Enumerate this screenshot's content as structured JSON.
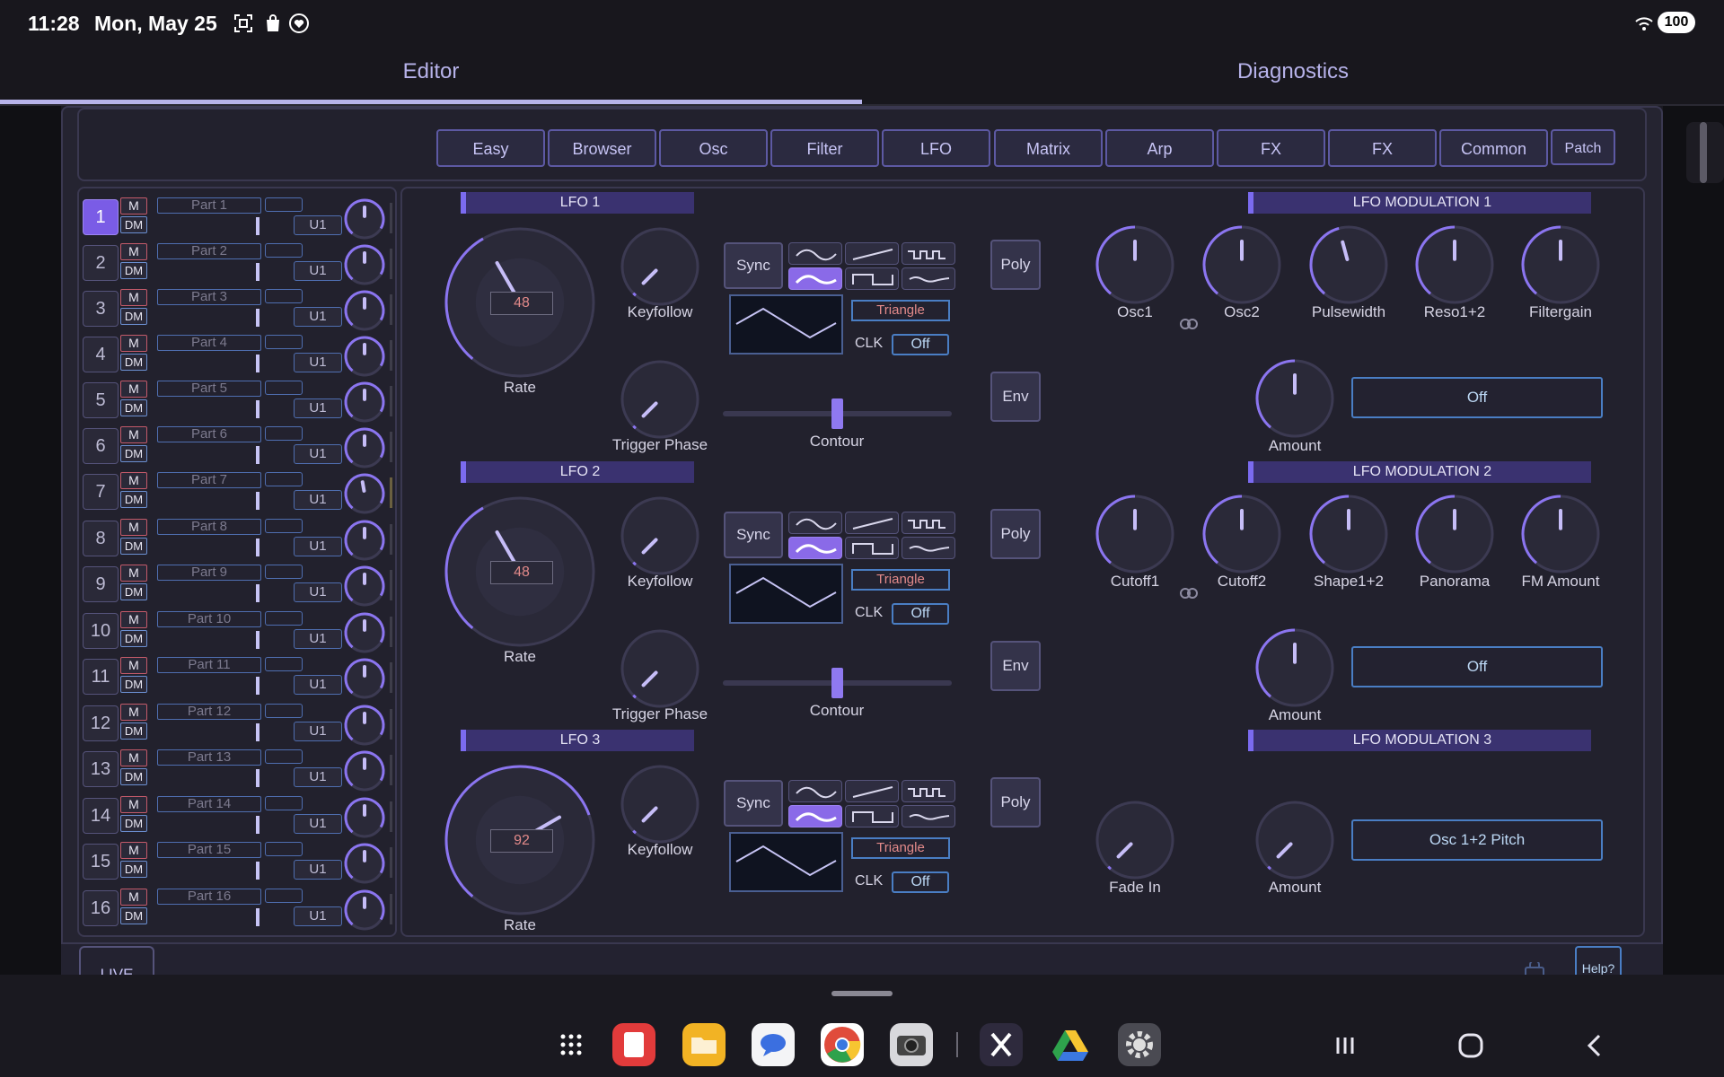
{
  "status": {
    "time": "11:28",
    "date": "Mon, May 25",
    "battery": "100"
  },
  "tabs": {
    "editor": "Editor",
    "diagnostics": "Diagnostics"
  },
  "nav": {
    "buttons": [
      "Easy",
      "Browser",
      "Osc",
      "Filter",
      "LFO",
      "Matrix",
      "Arp",
      "FX",
      "FX",
      "Common",
      "Patch"
    ]
  },
  "parts": {
    "m_label": "M",
    "dm_label": "DM",
    "selected": 1,
    "items": [
      {
        "num": "1",
        "name": "Part 1",
        "unit": "U1"
      },
      {
        "num": "2",
        "name": "Part 2",
        "unit": "U1"
      },
      {
        "num": "3",
        "name": "Part 3",
        "unit": "U1"
      },
      {
        "num": "4",
        "name": "Part 4",
        "unit": "U1"
      },
      {
        "num": "5",
        "name": "Part 5",
        "unit": "U1"
      },
      {
        "num": "6",
        "name": "Part 6",
        "unit": "U1"
      },
      {
        "num": "7",
        "name": "Part 7",
        "unit": "U1"
      },
      {
        "num": "8",
        "name": "Part 8",
        "unit": "U1"
      },
      {
        "num": "9",
        "name": "Part 9",
        "unit": "U1"
      },
      {
        "num": "10",
        "name": "Part 10",
        "unit": "U1"
      },
      {
        "num": "11",
        "name": "Part 11",
        "unit": "U1"
      },
      {
        "num": "12",
        "name": "Part 12",
        "unit": "U1"
      },
      {
        "num": "13",
        "name": "Part 13",
        "unit": "U1"
      },
      {
        "num": "14",
        "name": "Part 14",
        "unit": "U1"
      },
      {
        "num": "15",
        "name": "Part 15",
        "unit": "U1"
      },
      {
        "num": "16",
        "name": "Part 16",
        "unit": "U1"
      }
    ]
  },
  "lfo": [
    {
      "title": "LFO 1",
      "rate_value": "48",
      "rate_label": "Rate",
      "keyfollow_label": "Keyfollow",
      "trigger_label": "Trigger Phase",
      "sync_label": "Sync",
      "shape": "Triangle",
      "clk_label": "CLK",
      "clk_value": "Off",
      "contour_label": "Contour",
      "poly_label": "Poly",
      "env_label": "Env"
    },
    {
      "title": "LFO 2",
      "rate_value": "48",
      "rate_label": "Rate",
      "keyfollow_label": "Keyfollow",
      "trigger_label": "Trigger Phase",
      "sync_label": "Sync",
      "shape": "Triangle",
      "clk_label": "CLK",
      "clk_value": "Off",
      "contour_label": "Contour",
      "poly_label": "Poly",
      "env_label": "Env"
    },
    {
      "title": "LFO 3",
      "rate_value": "92",
      "rate_label": "Rate",
      "keyfollow_label": "Keyfollow",
      "sync_label": "Sync",
      "shape": "Triangle",
      "clk_label": "CLK",
      "clk_value": "Off",
      "poly_label": "Poly"
    }
  ],
  "mod": [
    {
      "title": "LFO MODULATION 1",
      "knobs": [
        "Osc1",
        "Osc2",
        "Pulsewidth",
        "Reso1+2",
        "Filtergain"
      ],
      "amount_label": "Amount",
      "target": "Off"
    },
    {
      "title": "LFO MODULATION 2",
      "knobs": [
        "Cutoff1",
        "Cutoff2",
        "Shape1+2",
        "Panorama",
        "FM Amount"
      ],
      "amount_label": "Amount",
      "target": "Off"
    },
    {
      "title": "LFO MODULATION 3",
      "fade_label": "Fade In",
      "amount_label": "Amount",
      "target": "Osc 1+2 Pitch"
    }
  ],
  "bottom": {
    "live": "LIVE",
    "help": "Help?"
  },
  "colors": {
    "accent": "#8a6ae8",
    "panel": "#22212d",
    "lcd_text": "#e38a8a",
    "link_blue": "#4a7ec4"
  }
}
